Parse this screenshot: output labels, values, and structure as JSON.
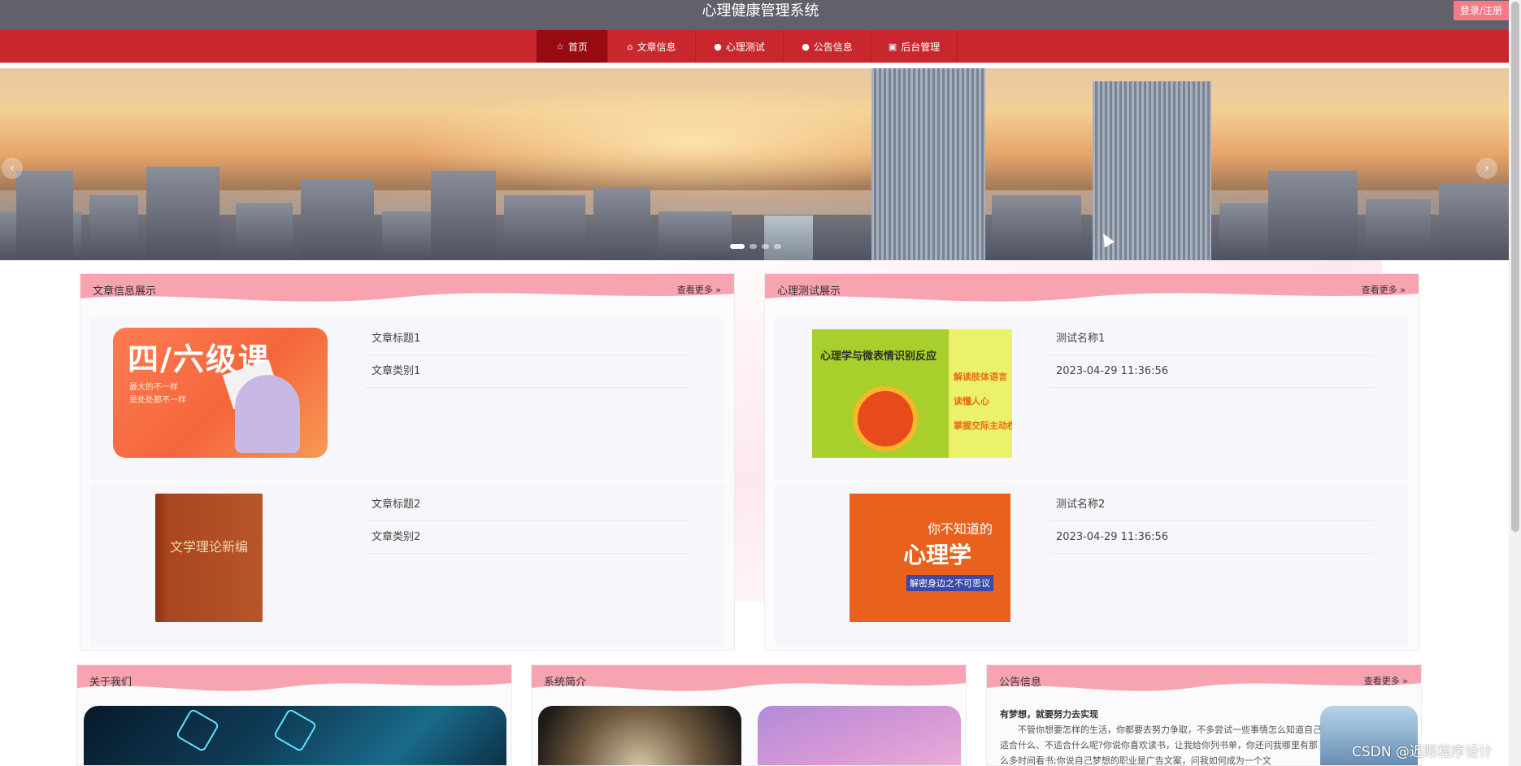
{
  "header": {
    "title": "心理健康管理系统",
    "login_label": "登录/注册"
  },
  "nav": {
    "items": [
      {
        "label": "首页",
        "icon": "star-icon",
        "active": true
      },
      {
        "label": "文章信息",
        "icon": "home-icon",
        "active": false
      },
      {
        "label": "心理测试",
        "icon": "info-circle-icon",
        "active": false
      },
      {
        "label": "公告信息",
        "icon": "question-circle-icon",
        "active": false
      },
      {
        "label": "后台管理",
        "icon": "calendar-icon",
        "active": false
      }
    ]
  },
  "banner": {
    "prev": "‹",
    "next": "›",
    "slide_count": 4,
    "active_slide": 1
  },
  "articles_panel": {
    "title": "文章信息展示",
    "more": "查看更多",
    "items": [
      {
        "title": "文章标题1",
        "category": "文章类别1",
        "thumb_text": "四/六级课",
        "thumb_sub1": "最大的不一样",
        "thumb_sub2": "是处处都不一样"
      },
      {
        "title": "文章标题2",
        "category": "文章类别2",
        "thumb_text": "文学理论新编"
      }
    ]
  },
  "tests_panel": {
    "title": "心理测试展示",
    "more": "查看更多",
    "items": [
      {
        "name": "测试名称1",
        "time": "2023-04-29 11:36:56",
        "thumb_title": "心理学与微表情识别反应",
        "thumb_side1": "解读肢体语言",
        "thumb_side2": "读懂人心",
        "thumb_side3": "掌握交际主动权"
      },
      {
        "name": "测试名称2",
        "time": "2023-04-29 11:36:56",
        "thumb_title": "你不知道的",
        "thumb_title2": "心理学",
        "thumb_sub": "解密身边之不可思议"
      }
    ]
  },
  "about_panel": {
    "title": "关于我们"
  },
  "intro_panel": {
    "title": "系统简介"
  },
  "notice_panel": {
    "title": "公告信息",
    "more": "查看更多",
    "notice_title": "有梦想，就要努力去实现",
    "notice_text": "不管你想要怎样的生活，你都要去努力争取，不多尝试一些事情怎么知道自己适合什么、不适合什么呢?你说你喜欢读书，让我给你列书单，你还问我哪里有那么多时间看书;你说自己梦想的职业是广告文案，问我如何成为一个文"
  },
  "watermark": "CSDN @迟限程序设计",
  "colors": {
    "titlebar": "#62606b",
    "nav": "#c8282d",
    "nav_active": "#960a10",
    "panel_head": "#f8a3b0",
    "login": "#f27b86"
  }
}
